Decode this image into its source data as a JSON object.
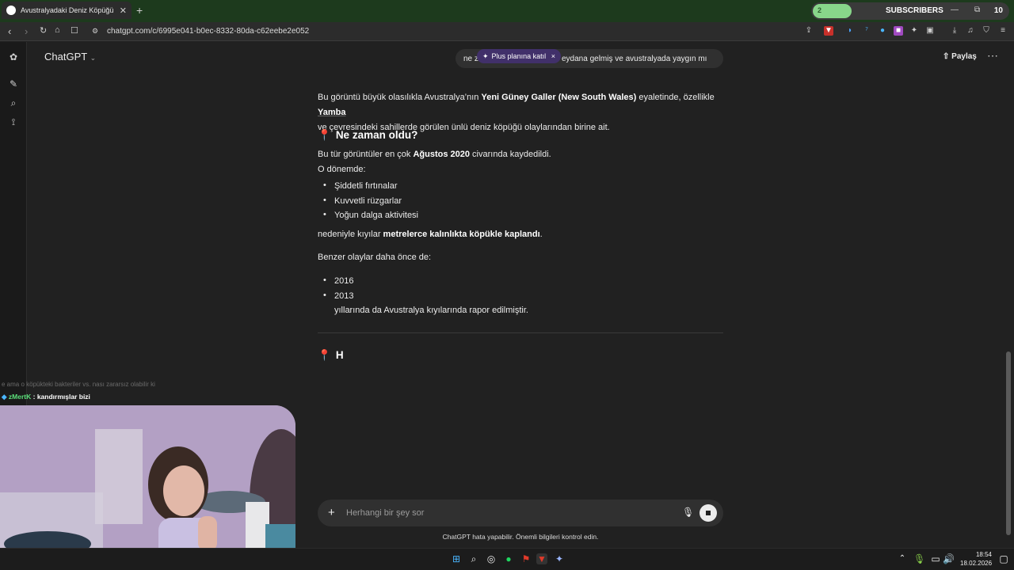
{
  "browser": {
    "tab_title": "Avustralyadaki Deniz Köpüğü",
    "tab_close": "✕",
    "new_tab": "+",
    "url": "chatgpt.com/c/6995e041-b0ec-8332-80da-c62eebe2e052"
  },
  "subscriber_widget": {
    "current": "2",
    "label": "SUBSCRIBERS",
    "goal": "10",
    "progress_fraction": 0.2,
    "minimize": "—",
    "restore": "⧉",
    "close": "✕"
  },
  "chatgpt": {
    "model_label": "ChatGPT",
    "share_label": "Paylaş",
    "user_message_start": "ne z",
    "user_message_end": "eydana gelmiş ve avustralyada yaygın mı",
    "plus_badge": "Plus planına katıl",
    "plus_badge_close": "×",
    "answer": {
      "intro_1": "Bu görüntü büyük olasılıkla Avustralya’nın ",
      "intro_bold": "Yeni Güney Galler (New South Wales)",
      "intro_2": " eyaletinde, özellikle ",
      "intro_place": "Yamba",
      "intro_3": "ve çevresindeki sahillerde görülen ünlü deniz köpüğü olaylarından birine ait.",
      "heading_when": "Ne zaman oldu?",
      "when_1": "Bu tür görüntüler en çok ",
      "when_bold": "Ağustos 2020",
      "when_2": " civarında kaydedildi.",
      "period_label": "O dönemde:",
      "causes": [
        "Şiddetli fırtınalar",
        "Kuvvetli rüzgarlar",
        "Yoğun dalga aktivitesi"
      ],
      "result_1": "nedeniyle kıyılar ",
      "result_bold": "metrelerce kalınlıkta köpükle kaplandı",
      "result_2": ".",
      "similar_label": "Benzer olaylar daha önce de:",
      "years": [
        "2016",
        "2013"
      ],
      "years_tail": "yıllarında da Avustralya kıyılarında rapor edilmiştir.",
      "heading_partial": "H"
    },
    "composer_placeholder": "Herhangi bir şey sor",
    "disclaimer": "ChatGPT hata yapabilir. Önemli bilgileri kontrol edin."
  },
  "stream_chat": {
    "faded_message": "e ama o köpükteki bakteriler vs. nası zararsız olabilir ki",
    "user": "zMertK",
    "message": ": kandırmışlar bizi"
  },
  "taskbar": {
    "time": "18:54",
    "date": "18.02.2026"
  }
}
